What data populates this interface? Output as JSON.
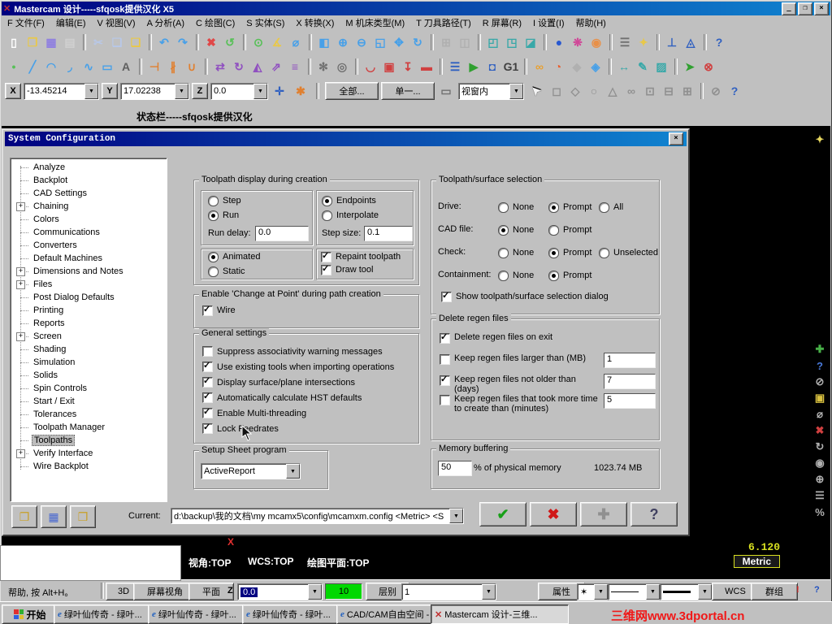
{
  "icons": {
    "minimize": "_",
    "maximize": "❐",
    "close": "×",
    "dropdown": "▼",
    "dialog_ok": "✔",
    "dialog_cancel": "✖",
    "dialog_apply": "✚",
    "dialog_help": "?",
    "open_config": "❐",
    "save_config": "▦",
    "merge_config": "❒",
    "autocursor": "✛",
    "fastpoint": "✱",
    "doc_select": "▭",
    "cursor_arrow": "➤",
    "excl": "!",
    "quest": "?",
    "attr_star": "✶",
    "mastercam": "✕"
  },
  "window": {
    "title": "Mastercam  设计-----sfqosk提供汉化 X5"
  },
  "menu": {
    "items": [
      "F 文件(F)",
      "编辑(E)",
      "V 视图(V)",
      "A 分析(A)",
      "C 绘图(C)",
      "S 实体(S)",
      "X 转换(X)",
      "M 机床类型(M)",
      "T 刀具路径(T)",
      "R 屏幕(R)",
      "I 设置(I)",
      "帮助(H)"
    ]
  },
  "toolbar1": {
    "icons": [
      [
        "new-file",
        "▯",
        "#ffffff"
      ],
      [
        "open-file",
        "❐",
        "#e8c84a"
      ],
      [
        "save",
        "▦",
        "#8f7fe0"
      ],
      [
        "print",
        "▤",
        "#d0d0d0"
      ],
      [
        "sep"
      ],
      [
        "cut",
        "✂",
        "#b8c8e8"
      ],
      [
        "copy",
        "❏",
        "#b8c8e8"
      ],
      [
        "paste",
        "❑",
        "#e8c84a"
      ],
      [
        "sep"
      ],
      [
        "undo",
        "↶",
        "#48a0e8"
      ],
      [
        "redo",
        "↷",
        "#48a0e8"
      ],
      [
        "sep"
      ],
      [
        "delete",
        "✖",
        "#e04848"
      ],
      [
        "undelete",
        "↺",
        "#58c058"
      ],
      [
        "sep"
      ],
      [
        "analyze-point",
        "⊙",
        "#58c058"
      ],
      [
        "analyze-angle",
        "∡",
        "#e8c84a"
      ],
      [
        "analyze-distance",
        "⌀",
        "#48a0e8"
      ],
      [
        "sep"
      ],
      [
        "zoom-window",
        "◧",
        "#48a0e8"
      ],
      [
        "zoom-in",
        "⊕",
        "#48a0e8"
      ],
      [
        "zoom-out",
        "⊖",
        "#48a0e8"
      ],
      [
        "zoom-fit",
        "◱",
        "#48a0e8"
      ],
      [
        "pan",
        "✥",
        "#48a0e8"
      ],
      [
        "repaint",
        "↻",
        "#48a0e8"
      ],
      [
        "sep"
      ],
      [
        "grid",
        "⊞",
        "#b0b0b0"
      ],
      [
        "viewports",
        "◫",
        "#b0b0b0"
      ],
      [
        "sep"
      ],
      [
        "view-top",
        "◰",
        "#38a8a8"
      ],
      [
        "view-front",
        "◳",
        "#38a8a8"
      ],
      [
        "view-iso",
        "◪",
        "#38a8a8"
      ],
      [
        "sep"
      ],
      [
        "shade-sphere",
        "●",
        "#2858d0"
      ],
      [
        "color-wheel",
        "❋",
        "#d04898"
      ],
      [
        "material",
        "◉",
        "#e89048"
      ],
      [
        "sep"
      ],
      [
        "level-manager",
        "☰",
        "#707070"
      ],
      [
        "attributes",
        "✦",
        "#e8c84a"
      ],
      [
        "sep"
      ],
      [
        "wcs-plane",
        "⊥",
        "#3060c0"
      ],
      [
        "planes",
        "◬",
        "#3060c0"
      ],
      [
        "sep"
      ],
      [
        "help",
        "?",
        "#3060c0"
      ]
    ]
  },
  "toolbar2": {
    "icons": [
      [
        "create-point",
        "•",
        "#58c058"
      ],
      [
        "create-line",
        "╱",
        "#48a0e8"
      ],
      [
        "create-arc",
        "◠",
        "#48a0e8"
      ],
      [
        "create-fillet",
        "◞",
        "#48a0e8"
      ],
      [
        "create-spline",
        "∿",
        "#48a0e8"
      ],
      [
        "create-rect",
        "▭",
        "#48a0e8"
      ],
      [
        "create-letters",
        "A",
        "#606060"
      ],
      [
        "sep"
      ],
      [
        "trim",
        "⊣",
        "#e08030"
      ],
      [
        "break",
        "∦",
        "#e08030"
      ],
      [
        "join",
        "∪",
        "#e08030"
      ],
      [
        "sep"
      ],
      [
        "xform-translate",
        "⇄",
        "#9050c0"
      ],
      [
        "xform-rotate",
        "↻",
        "#9050c0"
      ],
      [
        "xform-mirror",
        "◭",
        "#9050c0"
      ],
      [
        "xform-scale",
        "⇗",
        "#9050c0"
      ],
      [
        "xform-offset",
        "≡",
        "#9050c0"
      ],
      [
        "sep"
      ],
      [
        "machine-mill",
        "✻",
        "#707070"
      ],
      [
        "machine-lathe",
        "◎",
        "#707070"
      ],
      [
        "sep"
      ],
      [
        "toolpath-contour",
        "◡",
        "#d04040"
      ],
      [
        "toolpath-pocket",
        "▣",
        "#d04040"
      ],
      [
        "toolpath-drill",
        "↧",
        "#d04040"
      ],
      [
        "toolpath-face",
        "▬",
        "#d04040"
      ],
      [
        "sep"
      ],
      [
        "operations-manager",
        "☰",
        "#3060c0"
      ],
      [
        "backplot",
        "▶",
        "#30a030"
      ],
      [
        "verify",
        "◘",
        "#3060c0"
      ],
      [
        "post",
        "G1",
        "#404040"
      ],
      [
        "sep"
      ],
      [
        "chain",
        "∞",
        "#e8a030"
      ],
      [
        "surface",
        "◔",
        "#e86030"
      ],
      [
        "solids",
        "◆",
        "#b0b0b0"
      ],
      [
        "wireframe-3d",
        "◈",
        "#48a0e8"
      ],
      [
        "sep"
      ],
      [
        "dimensions",
        "↔",
        "#38a8a8"
      ],
      [
        "note",
        "✎",
        "#38a8a8"
      ],
      [
        "hatch",
        "▨",
        "#38a8a8"
      ],
      [
        "sep"
      ],
      [
        "run-addin",
        "➤",
        "#30a030"
      ],
      [
        "exit-app",
        "⊗",
        "#d04040"
      ]
    ]
  },
  "coordbar": {
    "x_label": "X",
    "x_value": "-13.45214",
    "y_label": "Y",
    "y_value": "17.02238",
    "z_label": "Z",
    "z_value": "0.0",
    "all_label": "全部...",
    "single_label": "单一...",
    "window_mode": "视窗内",
    "sel_icons": [
      [
        "select-box",
        "◻",
        "#909090"
      ],
      [
        "select-poly",
        "◇",
        "#909090"
      ],
      [
        "select-circle",
        "○",
        "#909090"
      ],
      [
        "select-vector",
        "△",
        "#909090"
      ],
      [
        "select-chain",
        "∞",
        "#909090"
      ],
      [
        "select-window",
        "⊡",
        "#909090"
      ],
      [
        "select-inside",
        "⊟",
        "#909090"
      ],
      [
        "select-outside",
        "⊞",
        "#909090"
      ],
      [
        "sep"
      ],
      [
        "select-none",
        "⊘",
        "#909090"
      ],
      [
        "select-help",
        "?",
        "#3060c0"
      ]
    ]
  },
  "prompt": {
    "text": "状态栏-----sfqosk提供汉化"
  },
  "right_toolbar": {
    "icons": [
      [
        "gview-gear",
        "✦",
        "#e8d860"
      ],
      [
        "gap"
      ],
      [
        "add",
        "✚",
        "#48b048"
      ],
      [
        "rt-help",
        "?",
        "#4878d8"
      ],
      [
        "none",
        "⊘",
        "#b0b0b0"
      ],
      [
        "swatch",
        "▣",
        "#d8c040"
      ],
      [
        "measure",
        "⌀",
        "#b0b0b0"
      ],
      [
        "rt-delete",
        "✖",
        "#d04040"
      ],
      [
        "refresh",
        "↻",
        "#b0b0b0"
      ],
      [
        "camera",
        "◉",
        "#b0b0b0"
      ],
      [
        "rt-zoom",
        "⊕",
        "#b0b0b0"
      ],
      [
        "rt-levels",
        "☰",
        "#b0b0b0"
      ],
      [
        "percent",
        "%",
        "#b0b0b0"
      ]
    ]
  },
  "dialog": {
    "title": "System Configuration",
    "tree": [
      {
        "label": "Analyze"
      },
      {
        "label": "Backplot"
      },
      {
        "label": "CAD Settings"
      },
      {
        "label": "Chaining",
        "expandable": true
      },
      {
        "label": "Colors"
      },
      {
        "label": "Communications"
      },
      {
        "label": "Converters"
      },
      {
        "label": "Default Machines"
      },
      {
        "label": "Dimensions and Notes",
        "expandable": true
      },
      {
        "label": "Files",
        "expandable": true
      },
      {
        "label": "Post Dialog Defaults"
      },
      {
        "label": "Printing"
      },
      {
        "label": "Reports"
      },
      {
        "label": "Screen",
        "expandable": true
      },
      {
        "label": "Shading"
      },
      {
        "label": "Simulation"
      },
      {
        "label": "Solids"
      },
      {
        "label": "Spin Controls"
      },
      {
        "label": "Start / Exit"
      },
      {
        "label": "Tolerances"
      },
      {
        "label": "Toolpath Manager"
      },
      {
        "label": "Toolpaths",
        "selected": true
      },
      {
        "label": "Verify Interface",
        "expandable": true
      },
      {
        "label": "Wire Backplot"
      }
    ],
    "display": {
      "title": "Toolpath display during creation",
      "mode": [
        {
          "label": "Step",
          "sel": false
        },
        {
          "label": "Run",
          "sel": true
        }
      ],
      "run_delay": {
        "label": "Run delay:",
        "value": "0.0"
      },
      "ends": [
        {
          "label": "Endpoints",
          "sel": true
        },
        {
          "label": "Interpolate",
          "sel": false
        }
      ],
      "step_size": {
        "label": "Step size:",
        "value": "0.1"
      },
      "anim": [
        {
          "label": "Animated",
          "sel": true
        },
        {
          "label": "Static",
          "sel": false
        }
      ],
      "paint": [
        {
          "label": "Repaint toolpath",
          "chk": true
        },
        {
          "label": "Draw tool",
          "chk": true
        }
      ]
    },
    "change_point": {
      "title": "Enable 'Change at Point' during path creation",
      "checks": [
        {
          "label": "Wire",
          "chk": true
        }
      ]
    },
    "general": {
      "title": "General settings",
      "checks": [
        {
          "label": "Suppress associativity warning messages",
          "chk": false
        },
        {
          "label": "Use existing tools when importing operations",
          "chk": true
        },
        {
          "label": "Display surface/plane intersections",
          "chk": true
        },
        {
          "label": "Automatically calculate HST defaults",
          "chk": true
        },
        {
          "label": "Enable Multi-threading",
          "chk": true
        },
        {
          "label": "Lock Feedrates",
          "chk": true
        }
      ]
    },
    "setup_sheet": {
      "title": "Setup Sheet program",
      "value": "ActiveReport"
    },
    "selection": {
      "title": "Toolpath/surface selection",
      "rows": [
        {
          "label": "Drive:",
          "options": [
            {
              "label": "None",
              "sel": false
            },
            {
              "label": "Prompt",
              "sel": true
            },
            {
              "label": "All",
              "sel": false
            }
          ]
        },
        {
          "label": "CAD file:",
          "options": [
            {
              "label": "None",
              "sel": true
            },
            {
              "label": "Prompt",
              "sel": false
            }
          ]
        },
        {
          "label": "Check:",
          "options": [
            {
              "label": "None",
              "sel": false
            },
            {
              "label": "Prompt",
              "sel": true
            },
            {
              "label": "Unselected",
              "sel": false
            }
          ]
        },
        {
          "label": "Containment:",
          "options": [
            {
              "label": "None",
              "sel": false
            },
            {
              "label": "Prompt",
              "sel": true
            }
          ]
        }
      ],
      "show_dialog": {
        "label": "Show toolpath/surface selection dialog",
        "chk": true
      }
    },
    "regen": {
      "title": "Delete regen files",
      "rows": [
        {
          "label": "Delete regen files on exit",
          "chk": true
        },
        {
          "label": "Keep regen files larger than (MB)",
          "chk": false,
          "value": "1"
        },
        {
          "label": "Keep regen files not older than (days)",
          "chk": true,
          "value": "7"
        },
        {
          "label": "Keep regen files that took more time to create than (minutes)",
          "chk": false,
          "value": "5"
        }
      ]
    },
    "memory": {
      "title": "Memory buffering",
      "value": "50",
      "suffix": "% of physical memory",
      "amount": "1023.74 MB"
    },
    "current": {
      "label": "Current:",
      "path": "d:\\backup\\我的文档\\my mcamx5\\config\\mcamxm.config <Metric> <S"
    }
  },
  "graphics": {
    "gview": "视角:TOP",
    "wcs": "WCS:TOP",
    "cplane": "绘图平面:TOP",
    "scale": "6.120",
    "units": "Metric",
    "origin_marker": "X"
  },
  "bottombar": {
    "help_hint": "帮助, 按 Alt+H。",
    "d3": "3D",
    "screen_view": "屏幕视角",
    "plane": "平面",
    "z_label": "Z",
    "z_value": "0.0",
    "feed_value": "10",
    "level_label": "层别",
    "level_value": "1",
    "attr_label": "属性",
    "wcs_label": "WCS",
    "group_label": "群组"
  },
  "taskbar": {
    "start": "开始",
    "tasks": [
      {
        "label": "绿叶仙传奇 - 绿叶...",
        "icon": "e"
      },
      {
        "label": "绿叶仙传奇 - 绿叶...",
        "icon": "e"
      },
      {
        "label": "绿叶仙传奇 - 绿叶...",
        "icon": "e"
      },
      {
        "label": "CAD/CAM自由空间 - ...",
        "icon": "e"
      },
      {
        "label": "Mastercam 设计-三维...",
        "icon": "✕",
        "active": true
      }
    ],
    "watermark": "三维网www.3dportal.cn"
  }
}
